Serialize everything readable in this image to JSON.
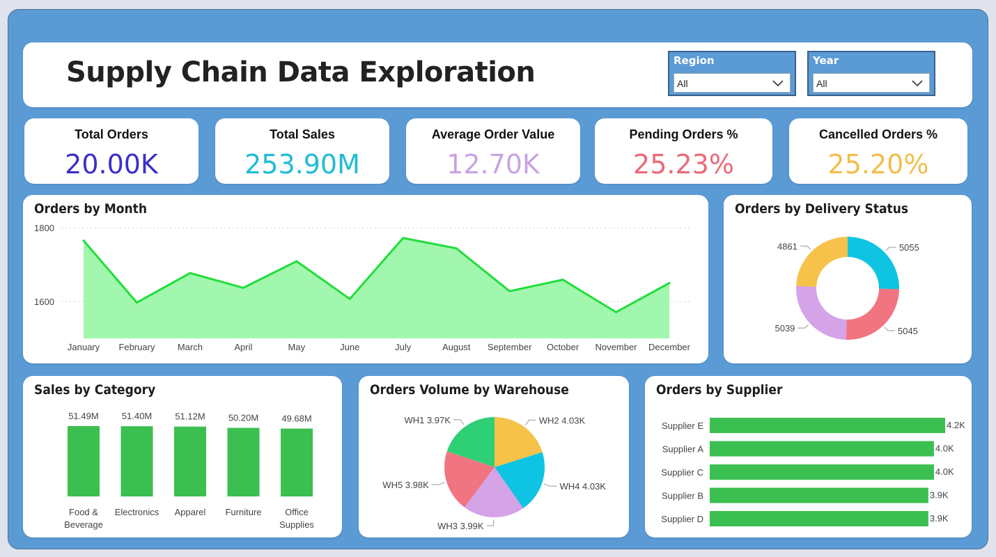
{
  "header": {
    "title": "Supply Chain Data Exploration",
    "filters": [
      {
        "label": "Region",
        "value": "All"
      },
      {
        "label": "Year",
        "value": "All"
      }
    ]
  },
  "kpis": [
    {
      "label": "Total Orders",
      "value": "20.00K",
      "color": "#3b2fc9"
    },
    {
      "label": "Total Sales",
      "value": "253.90M",
      "color": "#1fbcd3"
    },
    {
      "label": "Average Order Value",
      "value": "12.70K",
      "color": "#c9a2e3"
    },
    {
      "label": "Pending Orders %",
      "value": "25.23%",
      "color": "#e96a78"
    },
    {
      "label": "Cancelled Orders %",
      "value": "25.20%",
      "color": "#f2bd4b"
    }
  ],
  "charts": {
    "orders_by_month": {
      "title": "Orders by Month"
    },
    "delivery_status": {
      "title": "Orders by Delivery Status"
    },
    "sales_by_category": {
      "title": "Sales by Category"
    },
    "warehouse": {
      "title": "Orders Volume by Warehouse"
    },
    "supplier": {
      "title": "Orders by Supplier"
    }
  },
  "colors": {
    "line": "#22dd3a",
    "area": "#a1f7ae",
    "bar": "#3bbf50",
    "panel": "#5b9bd5"
  },
  "chart_data": [
    {
      "type": "area",
      "title": "Orders by Month",
      "categories": [
        "January",
        "February",
        "March",
        "April",
        "May",
        "June",
        "July",
        "August",
        "September",
        "October",
        "November",
        "December"
      ],
      "values": [
        1765,
        1597,
        1677,
        1637,
        1709,
        1607,
        1772,
        1744,
        1628,
        1659,
        1571,
        1650
      ],
      "yticks": [
        1600,
        1800
      ],
      "ylim": [
        1500,
        1800
      ]
    },
    {
      "type": "pie",
      "title": "Orders by Delivery Status",
      "donut": true,
      "labels": [
        "5055",
        "5045",
        "5039",
        "4861"
      ],
      "values": [
        5055,
        5045,
        5039,
        4861
      ],
      "colors": [
        "#0fc4e2",
        "#f07581",
        "#d4a3e8",
        "#f6c24a"
      ]
    },
    {
      "type": "bar",
      "title": "Sales by Category",
      "categories": [
        "Food & Beverage",
        "Electronics",
        "Apparel",
        "Furniture",
        "Office Supplies"
      ],
      "category_lines": [
        [
          "Food &",
          "Beverage"
        ],
        [
          "Electronics"
        ],
        [
          "Apparel"
        ],
        [
          "Furniture"
        ],
        [
          "Office",
          "Supplies"
        ]
      ],
      "values": [
        51.49,
        51.4,
        51.12,
        50.2,
        49.68
      ],
      "labels": [
        "51.49M",
        "51.40M",
        "51.12M",
        "50.20M",
        "49.68M"
      ]
    },
    {
      "type": "pie",
      "title": "Orders Volume by Warehouse",
      "labels": [
        "WH2 4.03K",
        "WH4 4.03K",
        "WH3 3.99K",
        "WH5 3.98K",
        "WH1 3.97K"
      ],
      "values": [
        4030,
        4030,
        3990,
        3980,
        3970
      ],
      "colors": [
        "#f6c24a",
        "#0fc4e2",
        "#d4a3e8",
        "#f07581",
        "#2ecf75"
      ]
    },
    {
      "type": "bar",
      "orientation": "horizontal",
      "title": "Orders by Supplier",
      "categories": [
        "Supplier E",
        "Supplier A",
        "Supplier C",
        "Supplier B",
        "Supplier D"
      ],
      "values": [
        4.2,
        4.0,
        4.0,
        3.9,
        3.9
      ],
      "labels": [
        "4.2K",
        "4.0K",
        "4.0K",
        "3.9K",
        "3.9K"
      ]
    }
  ]
}
